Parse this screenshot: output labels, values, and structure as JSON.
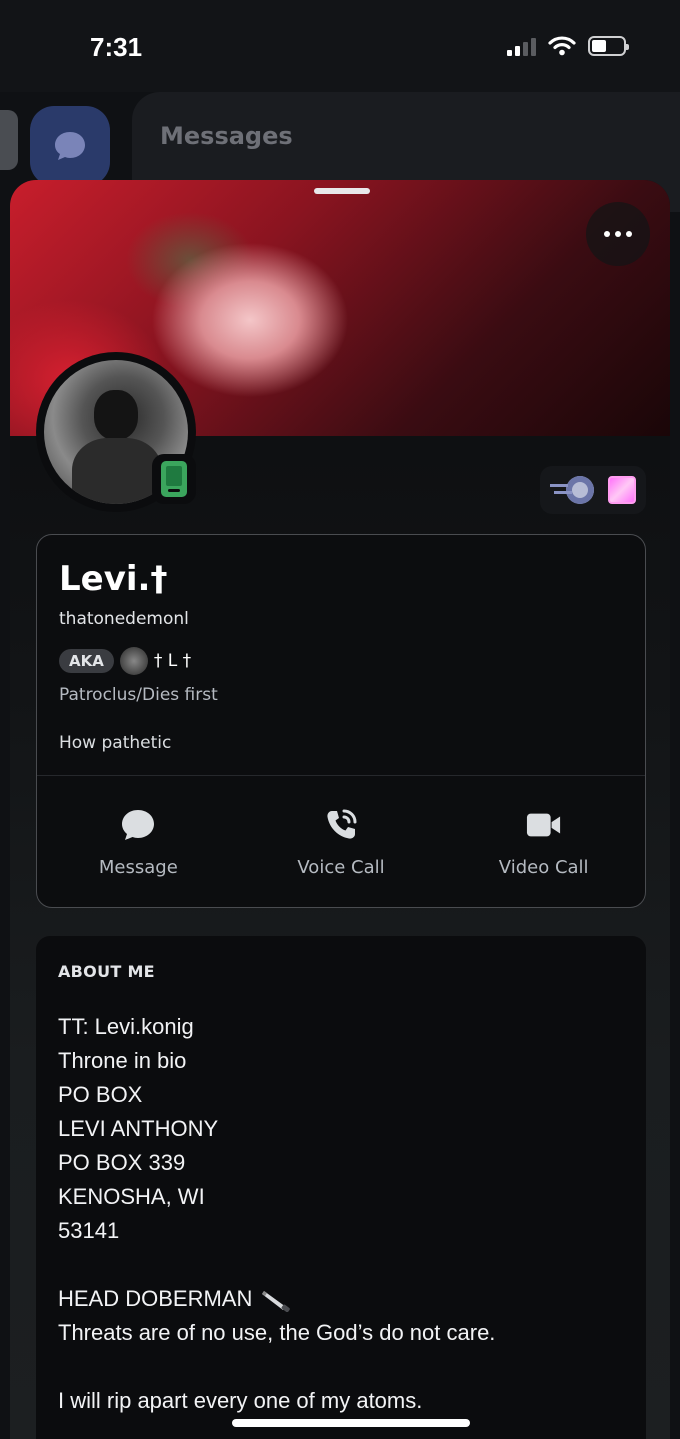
{
  "status_bar": {
    "time": "7:31"
  },
  "background": {
    "title": "Messages"
  },
  "profile": {
    "display_name": "Levi.†",
    "username": "thatonedemonl",
    "aka_label": "AKA",
    "aka_name": "† L †",
    "pronouns": "Patroclus/Dies first",
    "custom_status": "How pathetic"
  },
  "actions": [
    {
      "label": "Message",
      "icon": "chat-bubble-icon"
    },
    {
      "label": "Voice Call",
      "icon": "phone-icon"
    },
    {
      "label": "Video Call",
      "icon": "video-camera-icon"
    }
  ],
  "about": {
    "title": "ABOUT ME",
    "lines": [
      "TT: Levi.konig",
      "Throne in bio",
      "PO BOX",
      "LEVI ANTHONY",
      "PO BOX 339",
      "KENOSHA, WI",
      "53141",
      "",
      "HEAD DOBERMAN",
      "Threats are of no use, the God’s do not care.",
      "",
      "I will rip apart every one of my atoms."
    ]
  },
  "colors": {
    "online_mobile": "#3ba55d",
    "nitro_badge": "#ff73fa",
    "card_border": "#4a4c50"
  }
}
